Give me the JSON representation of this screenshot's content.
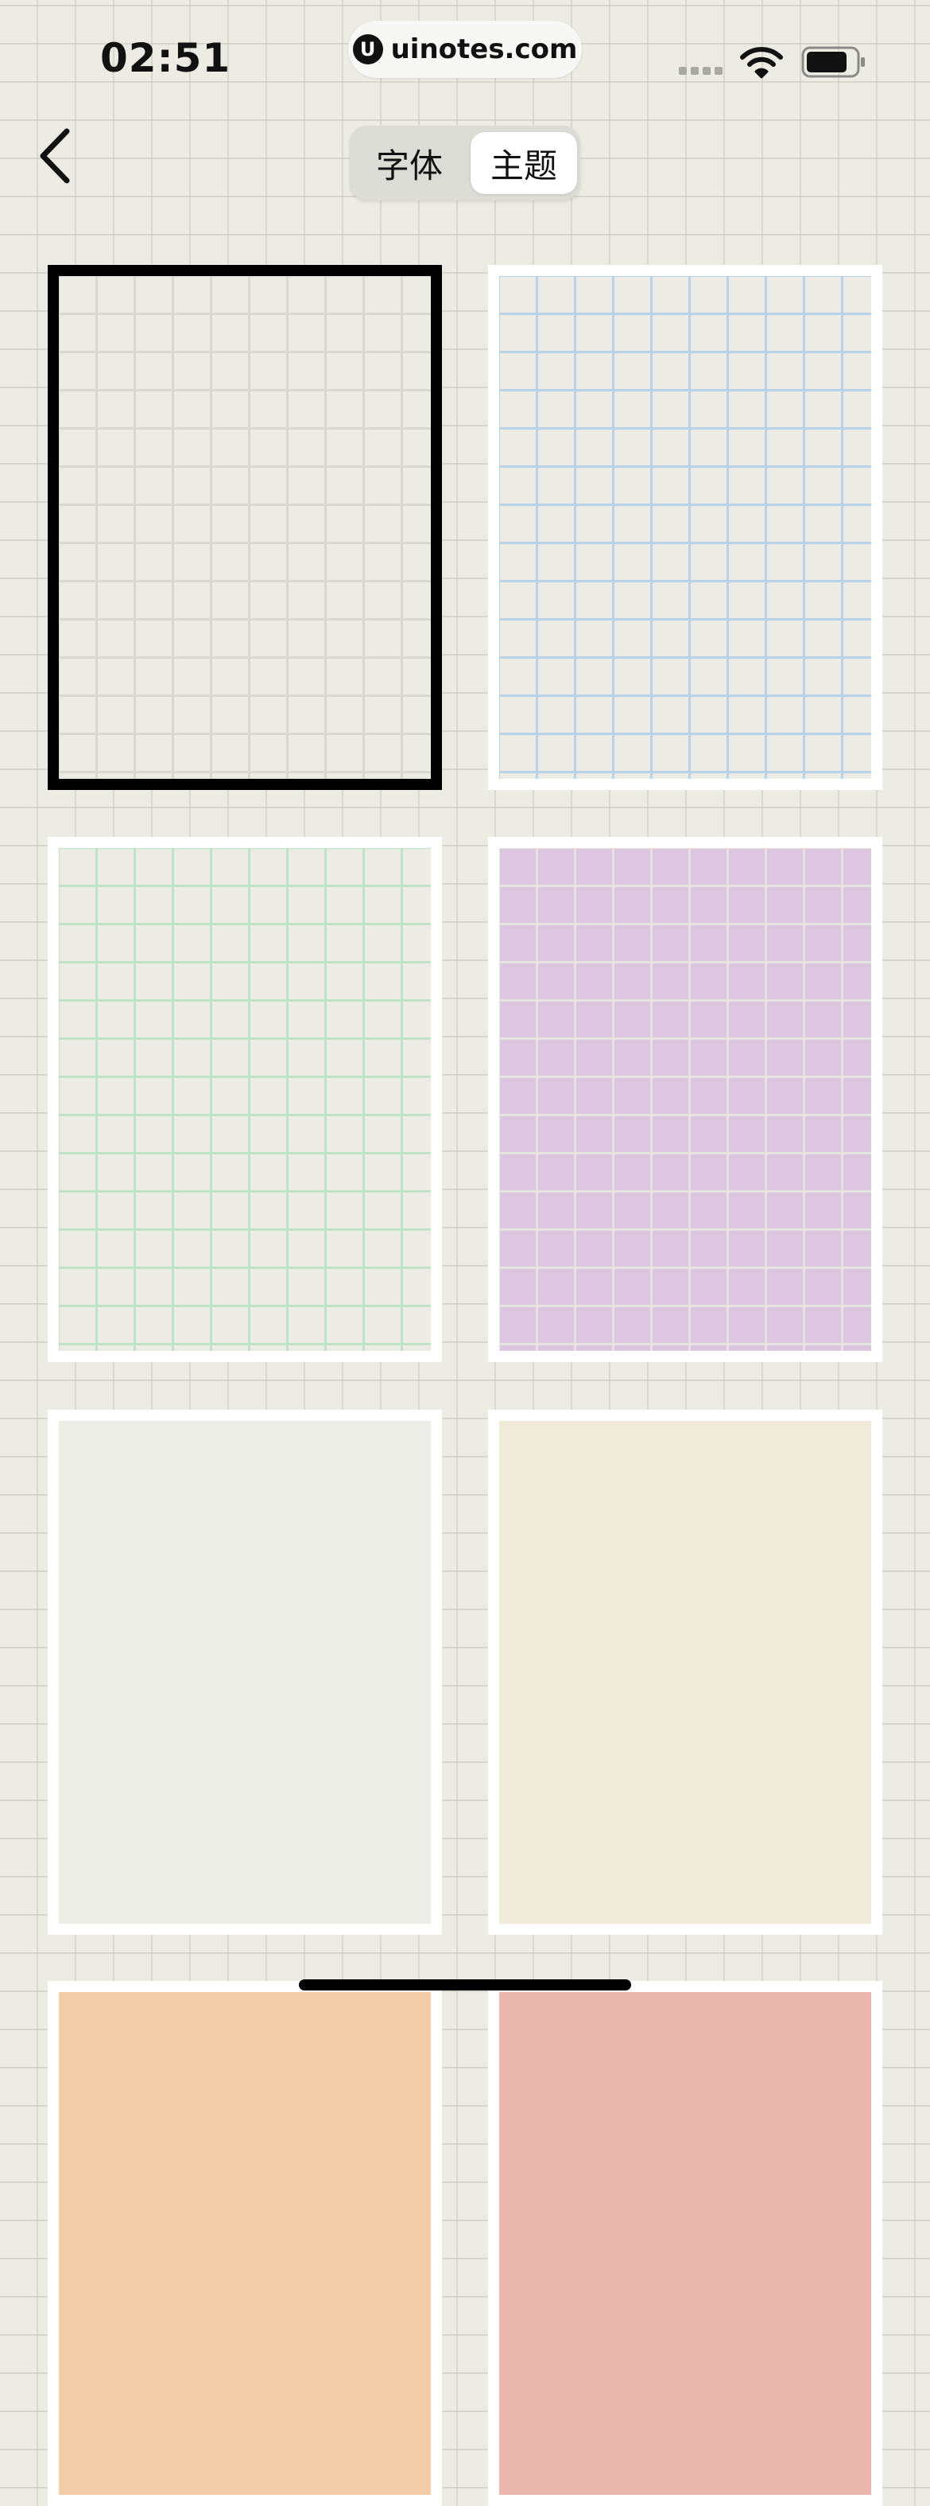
{
  "status_bar": {
    "time": "02:51",
    "url_logo": "U",
    "url": "uinotes.com",
    "icons": [
      "signal-icon",
      "wifi-icon",
      "battery-icon"
    ]
  },
  "nav": {
    "back_icon": "chevron-left-icon",
    "tabs": [
      {
        "label": "字体",
        "selected": false
      },
      {
        "label": "主题",
        "selected": true
      }
    ]
  },
  "themes": [
    {
      "name": "theme-grid-gray",
      "background": "#ecece4",
      "grid_color": "#d9d9d1",
      "selected": true
    },
    {
      "name": "theme-grid-blue",
      "background": "#ecece4",
      "grid_color": "#b9d3e8",
      "selected": false
    },
    {
      "name": "theme-grid-green",
      "background": "#ecece4",
      "grid_color": "#bfe3c8",
      "selected": false
    },
    {
      "name": "theme-grid-purple",
      "background": "#dcc6e0",
      "grid_color": "#e6e2e0",
      "selected": false
    },
    {
      "name": "theme-plain-gray",
      "background": "#ecede6",
      "grid_color": null,
      "selected": false
    },
    {
      "name": "theme-plain-beige",
      "background": "#f0eadb",
      "grid_color": null,
      "selected": false
    },
    {
      "name": "theme-plain-peach",
      "background": "#f3cda9",
      "grid_color": null,
      "selected": false
    },
    {
      "name": "theme-plain-pink",
      "background": "#ebb8b0",
      "grid_color": null,
      "selected": false
    }
  ]
}
